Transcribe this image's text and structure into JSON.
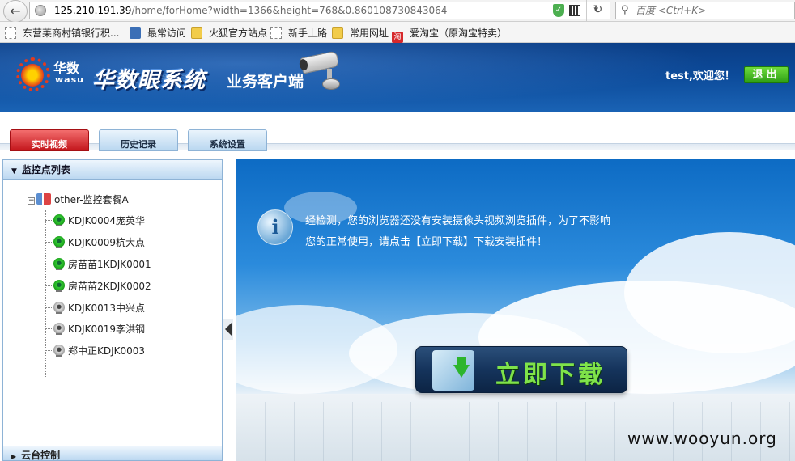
{
  "browser": {
    "url_host": "125.210.191.39",
    "url_path": "/home/forHome?width=1366&height=768&0.860108730843064",
    "search_placeholder": "百度 <Ctrl+K>",
    "bookmarks": [
      {
        "label": "东营莱商村镇银行积...",
        "icon": "page-icon"
      },
      {
        "label": "最常访问",
        "icon": "most-visited-icon"
      },
      {
        "label": "火狐官方站点",
        "icon": "folder-icon"
      },
      {
        "label": "新手上路",
        "icon": "page-icon"
      },
      {
        "label": "常用网址",
        "icon": "folder-icon"
      },
      {
        "label": "爱淘宝（原淘宝特卖）",
        "icon": "taobao-icon"
      }
    ]
  },
  "header": {
    "logo_cn": "华数",
    "logo_en": "wasu",
    "system_title": "华数眼系统",
    "subtitle": "业务客户端",
    "welcome": "test,欢迎您！",
    "logout_label": "退出"
  },
  "tabs": [
    {
      "label": "实时视频",
      "active": true
    },
    {
      "label": "历史记录",
      "active": false
    },
    {
      "label": "系统设置",
      "active": false
    }
  ],
  "sidebar": {
    "title": "监控点列表",
    "group": "other-监控套餐A",
    "nodes": [
      {
        "label": "KDJK0004庞英华",
        "status": "online"
      },
      {
        "label": "KDJK0009杭大点",
        "status": "online"
      },
      {
        "label": "房苗苗1KDJK0001",
        "status": "online"
      },
      {
        "label": "房苗苗2KDJK0002",
        "status": "online"
      },
      {
        "label": "KDJK0013中兴点",
        "status": "offline"
      },
      {
        "label": "KDJK0019李洪钢",
        "status": "offline"
      },
      {
        "label": "郑中正KDJK0003",
        "status": "offline"
      }
    ],
    "footer": "云台控制"
  },
  "main": {
    "notice_line1": "经检测，您的浏览器还没有安装摄像头视频浏览插件，为了不影响",
    "notice_line2": "您的正常使用，请点击【立即下载】下载安装插件！",
    "download_label": "立即下载"
  },
  "watermark": "www.wooyun.org",
  "colors": {
    "header_blue": "#0c4a99",
    "active_tab": "#c4161c",
    "logout_green": "#2e9f14",
    "online": "#1a9a1a",
    "offline": "#999999"
  }
}
